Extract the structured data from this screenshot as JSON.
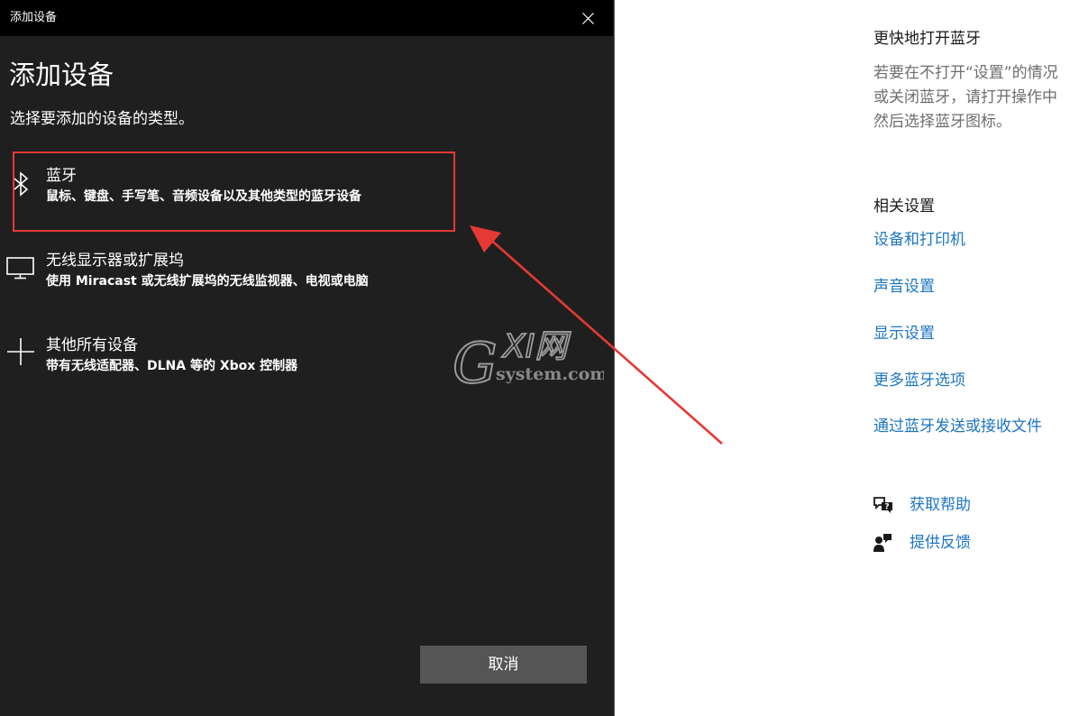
{
  "dialog": {
    "window_title": "添加设备",
    "heading": "添加设备",
    "subtitle": "选择要添加的设备的类型。",
    "options": [
      {
        "title": "蓝牙",
        "description": "鼠标、键盘、手写笔、音频设备以及其他类型的蓝牙设备",
        "icon": "bluetooth-icon"
      },
      {
        "title": "无线显示器或扩展坞",
        "description": "使用 Miracast 或无线扩展坞的无线监视器、电视或电脑",
        "icon": "monitor-icon"
      },
      {
        "title": "其他所有设备",
        "description": "带有无线适配器、DLNA 等的 Xbox 控制器",
        "icon": "plus-icon"
      }
    ],
    "cancel_label": "取消"
  },
  "watermark": {
    "brand": "XI网",
    "letter": "G",
    "domain": "system.com"
  },
  "panel": {
    "quick_title": "更快地打开蓝牙",
    "quick_text": [
      "若要在不打开“设置”的情况",
      "或关闭蓝牙，请打开操作中",
      "然后选择蓝牙图标。"
    ],
    "related_title": "相关设置",
    "links": [
      "设备和打印机",
      "声音设置",
      "显示设置",
      "更多蓝牙选项",
      "通过蓝牙发送或接收文件"
    ],
    "help_label": "获取帮助",
    "feedback_label": "提供反馈"
  },
  "colors": {
    "dialog_bg": "#1f1f1f",
    "titlebar_bg": "#000000",
    "highlight": "#e53935",
    "link": "#1c75c4",
    "button_bg": "#555555"
  }
}
